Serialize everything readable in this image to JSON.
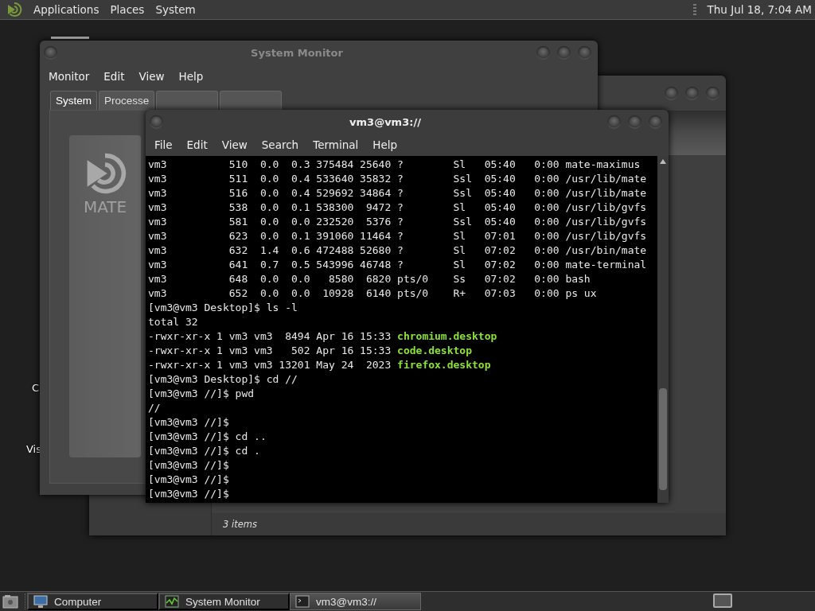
{
  "top_panel": {
    "menus": [
      "Applications",
      "Places",
      "System"
    ],
    "clock": "Thu Jul 18, 7:04 AM"
  },
  "desktop_icons": [
    {
      "label": "C"
    },
    {
      "label": "Vis"
    }
  ],
  "file_window": {
    "status": "3 items"
  },
  "monitor_window": {
    "title": "System Monitor",
    "menus": [
      "Monitor",
      "Edit",
      "View",
      "Help"
    ],
    "tabs": [
      {
        "label": "System",
        "selected": true
      },
      {
        "label": "Processe",
        "selected": false
      },
      {
        "selected": false
      },
      {
        "selected": false
      }
    ],
    "logo_text": "MATE"
  },
  "terminal": {
    "title": "vm3@vm3://",
    "menus": [
      "File",
      "Edit",
      "View",
      "Search",
      "Terminal",
      "Help"
    ],
    "lines": [
      {
        "text": "vm3          510  0.0  0.3 375484 25640 ?        Sl   05:40   0:00 mate-maximus"
      },
      {
        "text": "vm3          511  0.0  0.4 533640 35832 ?        Ssl  05:40   0:00 /usr/lib/mate"
      },
      {
        "text": "vm3          516  0.0  0.4 529692 34864 ?        Ssl  05:40   0:00 /usr/lib/mate"
      },
      {
        "text": "vm3          538  0.0  0.1 538300  9472 ?        Sl   05:40   0:00 /usr/lib/gvfs"
      },
      {
        "text": "vm3          581  0.0  0.0 232520  5376 ?        Ssl  05:40   0:00 /usr/lib/gvfs"
      },
      {
        "text": "vm3          623  0.0  0.1 391060 11464 ?        Sl   07:01   0:00 /usr/lib/gvfs"
      },
      {
        "text": "vm3          632  1.4  0.6 472488 52680 ?        Sl   07:02   0:00 /usr/bin/mate"
      },
      {
        "text": "vm3          641  0.7  0.5 543996 46748 ?        Sl   07:02   0:00 mate-terminal"
      },
      {
        "text": "vm3          648  0.0  0.0   8580  6820 pts/0    Ss   07:02   0:00 bash"
      },
      {
        "text": "vm3          652  0.0  0.0  10928  6140 pts/0    R+   07:03   0:00 ps ux"
      },
      {
        "text": "[vm3@vm3 Desktop]$ ls -l"
      },
      {
        "text": "total 32"
      },
      {
        "text": "-rwxr-xr-x 1 vm3 vm3  8494 Apr 16 15:33",
        "file": "chromium.desktop"
      },
      {
        "text": "-rwxr-xr-x 1 vm3 vm3   502 Apr 16 15:33",
        "file": "code.desktop"
      },
      {
        "text": "-rwxr-xr-x 1 vm3 vm3 13201 May 24  2023",
        "file": "firefox.desktop"
      },
      {
        "text": "[vm3@vm3 Desktop]$ cd //"
      },
      {
        "text": "[vm3@vm3 //]$ pwd"
      },
      {
        "text": "//"
      },
      {
        "text": "[vm3@vm3 //]$"
      },
      {
        "text": "[vm3@vm3 //]$ cd .."
      },
      {
        "text": "[vm3@vm3 //]$ cd ."
      },
      {
        "text": "[vm3@vm3 //]$"
      },
      {
        "text": "[vm3@vm3 //]$"
      },
      {
        "text": "[vm3@vm3 //]$"
      }
    ]
  },
  "taskbar": [
    {
      "label": "Computer",
      "kind": "computer",
      "selected": false
    },
    {
      "label": "System Monitor",
      "kind": "monitor",
      "selected": false
    },
    {
      "label": "vm3@vm3://",
      "kind": "terminal",
      "selected": true
    }
  ]
}
